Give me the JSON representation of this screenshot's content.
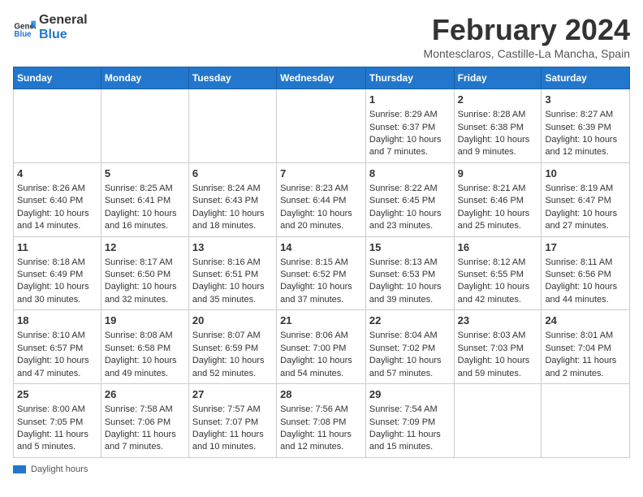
{
  "logo": {
    "line1": "General",
    "line2": "Blue"
  },
  "title": "February 2024",
  "subtitle": "Montesclaros, Castille-La Mancha, Spain",
  "days_of_week": [
    "Sunday",
    "Monday",
    "Tuesday",
    "Wednesday",
    "Thursday",
    "Friday",
    "Saturday"
  ],
  "legend_label": "Daylight hours",
  "weeks": [
    [
      {
        "day": "",
        "text": ""
      },
      {
        "day": "",
        "text": ""
      },
      {
        "day": "",
        "text": ""
      },
      {
        "day": "",
        "text": ""
      },
      {
        "day": "1",
        "text": "Sunrise: 8:29 AM\nSunset: 6:37 PM\nDaylight: 10 hours\nand 7 minutes."
      },
      {
        "day": "2",
        "text": "Sunrise: 8:28 AM\nSunset: 6:38 PM\nDaylight: 10 hours\nand 9 minutes."
      },
      {
        "day": "3",
        "text": "Sunrise: 8:27 AM\nSunset: 6:39 PM\nDaylight: 10 hours\nand 12 minutes."
      }
    ],
    [
      {
        "day": "4",
        "text": "Sunrise: 8:26 AM\nSunset: 6:40 PM\nDaylight: 10 hours\nand 14 minutes."
      },
      {
        "day": "5",
        "text": "Sunrise: 8:25 AM\nSunset: 6:41 PM\nDaylight: 10 hours\nand 16 minutes."
      },
      {
        "day": "6",
        "text": "Sunrise: 8:24 AM\nSunset: 6:43 PM\nDaylight: 10 hours\nand 18 minutes."
      },
      {
        "day": "7",
        "text": "Sunrise: 8:23 AM\nSunset: 6:44 PM\nDaylight: 10 hours\nand 20 minutes."
      },
      {
        "day": "8",
        "text": "Sunrise: 8:22 AM\nSunset: 6:45 PM\nDaylight: 10 hours\nand 23 minutes."
      },
      {
        "day": "9",
        "text": "Sunrise: 8:21 AM\nSunset: 6:46 PM\nDaylight: 10 hours\nand 25 minutes."
      },
      {
        "day": "10",
        "text": "Sunrise: 8:19 AM\nSunset: 6:47 PM\nDaylight: 10 hours\nand 27 minutes."
      }
    ],
    [
      {
        "day": "11",
        "text": "Sunrise: 8:18 AM\nSunset: 6:49 PM\nDaylight: 10 hours\nand 30 minutes."
      },
      {
        "day": "12",
        "text": "Sunrise: 8:17 AM\nSunset: 6:50 PM\nDaylight: 10 hours\nand 32 minutes."
      },
      {
        "day": "13",
        "text": "Sunrise: 8:16 AM\nSunset: 6:51 PM\nDaylight: 10 hours\nand 35 minutes."
      },
      {
        "day": "14",
        "text": "Sunrise: 8:15 AM\nSunset: 6:52 PM\nDaylight: 10 hours\nand 37 minutes."
      },
      {
        "day": "15",
        "text": "Sunrise: 8:13 AM\nSunset: 6:53 PM\nDaylight: 10 hours\nand 39 minutes."
      },
      {
        "day": "16",
        "text": "Sunrise: 8:12 AM\nSunset: 6:55 PM\nDaylight: 10 hours\nand 42 minutes."
      },
      {
        "day": "17",
        "text": "Sunrise: 8:11 AM\nSunset: 6:56 PM\nDaylight: 10 hours\nand 44 minutes."
      }
    ],
    [
      {
        "day": "18",
        "text": "Sunrise: 8:10 AM\nSunset: 6:57 PM\nDaylight: 10 hours\nand 47 minutes."
      },
      {
        "day": "19",
        "text": "Sunrise: 8:08 AM\nSunset: 6:58 PM\nDaylight: 10 hours\nand 49 minutes."
      },
      {
        "day": "20",
        "text": "Sunrise: 8:07 AM\nSunset: 6:59 PM\nDaylight: 10 hours\nand 52 minutes."
      },
      {
        "day": "21",
        "text": "Sunrise: 8:06 AM\nSunset: 7:00 PM\nDaylight: 10 hours\nand 54 minutes."
      },
      {
        "day": "22",
        "text": "Sunrise: 8:04 AM\nSunset: 7:02 PM\nDaylight: 10 hours\nand 57 minutes."
      },
      {
        "day": "23",
        "text": "Sunrise: 8:03 AM\nSunset: 7:03 PM\nDaylight: 10 hours\nand 59 minutes."
      },
      {
        "day": "24",
        "text": "Sunrise: 8:01 AM\nSunset: 7:04 PM\nDaylight: 11 hours\nand 2 minutes."
      }
    ],
    [
      {
        "day": "25",
        "text": "Sunrise: 8:00 AM\nSunset: 7:05 PM\nDaylight: 11 hours\nand 5 minutes."
      },
      {
        "day": "26",
        "text": "Sunrise: 7:58 AM\nSunset: 7:06 PM\nDaylight: 11 hours\nand 7 minutes."
      },
      {
        "day": "27",
        "text": "Sunrise: 7:57 AM\nSunset: 7:07 PM\nDaylight: 11 hours\nand 10 minutes."
      },
      {
        "day": "28",
        "text": "Sunrise: 7:56 AM\nSunset: 7:08 PM\nDaylight: 11 hours\nand 12 minutes."
      },
      {
        "day": "29",
        "text": "Sunrise: 7:54 AM\nSunset: 7:09 PM\nDaylight: 11 hours\nand 15 minutes."
      },
      {
        "day": "",
        "text": ""
      },
      {
        "day": "",
        "text": ""
      }
    ]
  ]
}
